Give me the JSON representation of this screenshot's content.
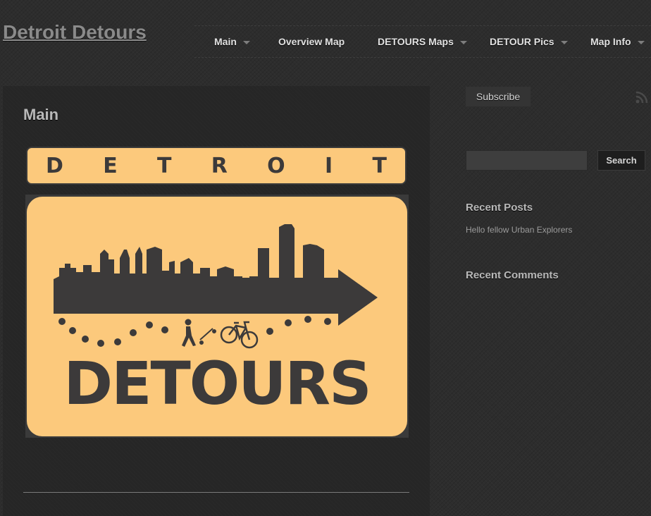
{
  "site": {
    "title": "Detroit Detours"
  },
  "nav": {
    "items": [
      {
        "label": "Main",
        "has_dropdown": true
      },
      {
        "label": "Overview Map",
        "has_dropdown": false
      },
      {
        "label": "DETOURS Maps",
        "has_dropdown": true
      },
      {
        "label": "DETOUR Pics",
        "has_dropdown": true
      },
      {
        "label": "Map Info",
        "has_dropdown": true
      }
    ]
  },
  "main": {
    "title": "Main",
    "logo": {
      "top_word": "DETROIT",
      "top_letters": [
        "D",
        "E",
        "T",
        "R",
        "O",
        "I",
        "T"
      ],
      "bottom_word": "DETOURS",
      "colors": {
        "background": "#fcc97c",
        "ink": "#3c3a3a"
      },
      "icons": [
        "skyline-arrow-icon",
        "pedestrian-icon",
        "skateboard-icon",
        "bicycle-icon"
      ]
    }
  },
  "sidebar": {
    "subscribe_label": "Subscribe",
    "rss_icon": "rss-icon",
    "search": {
      "value": "",
      "placeholder": "",
      "button_label": "Search"
    },
    "recent_posts": {
      "title": "Recent Posts",
      "items": [
        "Hello fellow Urban Explorers"
      ]
    },
    "recent_comments": {
      "title": "Recent Comments"
    }
  },
  "colors": {
    "page_bg": "#2d2d2d",
    "content_bg": "#262626",
    "accent_logo": "#fcc97c"
  }
}
